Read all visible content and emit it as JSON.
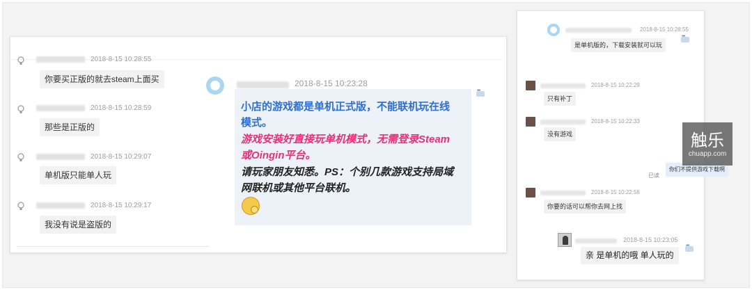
{
  "left_chat": {
    "messages": [
      {
        "time": "2018-8-15 10:28:55",
        "text": "你要买正版的就去steam上面买"
      },
      {
        "time": "2018-8-15 10:28:59",
        "text": "那些是正版的"
      },
      {
        "time": "2018-8-15 10:29:07",
        "text": "单机版只能单人玩"
      },
      {
        "time": "2018-8-15 10:29:17",
        "text": "我没有说是盗版的"
      }
    ]
  },
  "center_message": {
    "time": "2018-8-15 10:23:28",
    "lines": [
      "小店的游戏都是单机正式版，不能联机玩在线",
      "模式。",
      "游戏安装好直接玩单机模式，无需登录Steam",
      "或Oingin平台。",
      "请玩家朋友知悉。PS：个别几款游戏支持局域",
      "网联机或其他平台联机。"
    ],
    "emoji": "thinking-face-emoji",
    "colors": {
      "blue": "#2e6fd0",
      "pink": "#e6317a",
      "black": "#222222"
    }
  },
  "right_chat": {
    "messages": [
      {
        "time": "2018-8-15 10:28:55",
        "text": "是单机版的，下载安装就可以玩"
      },
      {
        "time": "2018-8-15 10:22:29",
        "text": "只有补丁"
      },
      {
        "time": "2018-8-15 10:22:33",
        "text": "没有游戏"
      },
      {
        "status": "已读",
        "text": "你们不提供游戏下载啊"
      },
      {
        "time": "2018-8-15 10:22:56",
        "text": "你要的话可以帮你去网上找"
      },
      {
        "time": "2018-8-15 10:23:05",
        "text": "亲 是单机的哦 单人玩的"
      }
    ]
  },
  "watermark": {
    "main": "触乐",
    "sub": "chuapp.com"
  }
}
